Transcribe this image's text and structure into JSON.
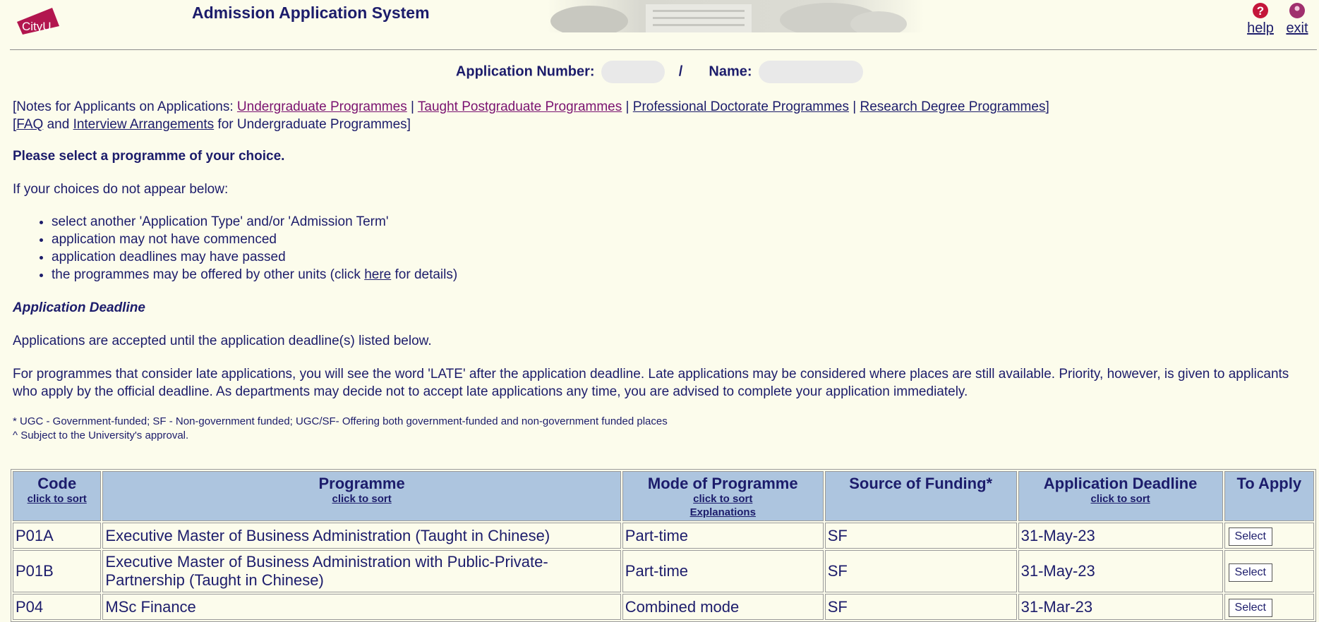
{
  "header": {
    "logo_text": "CityU",
    "title": "Admission Application System",
    "help_label": "help",
    "exit_label": "exit"
  },
  "applicant": {
    "number_label": "Application Number:",
    "separator": "/",
    "name_label": "Name:"
  },
  "notes": {
    "open": "[Notes for Applicants on Applications: ",
    "links": [
      "Undergraduate Programmes",
      "Taught Postgraduate Programmes",
      "Professional Doctorate Programmes",
      "Research Degree Programmes"
    ],
    "sep": " | ",
    "close": "]",
    "line2_open": "[",
    "faq": "FAQ",
    "and": " and ",
    "interview": "Interview Arrangements",
    "line2_close": " for Undergraduate Programmes]"
  },
  "instructions": {
    "select_title": "Please select a programme of your choice.",
    "if_missing": "If your choices do not appear below:",
    "reasons": [
      "select another 'Application Type' and/or 'Admission Term'",
      "application may not have commenced",
      "application deadlines may have passed"
    ],
    "reason4_pre": "the programmes may be offered by other units (click ",
    "reason4_link": "here",
    "reason4_post": " for details)",
    "deadline_heading": "Application Deadline",
    "accepted_text": "Applications are accepted until the application deadline(s) listed below.",
    "late_text": "For programmes that consider late applications, you will see the word 'LATE' after the application deadline. Late applications may be considered where places are still available. Priority, however, is given to applicants who apply by the official deadline. As departments may decide not to accept late applications any time, you are advised to complete your application immediately.",
    "footnote1": "* UGC - Government-funded; SF - Non-government funded; UGC/SF- Offering both government-funded and non-government funded places",
    "footnote2": "^ Subject to the University's approval."
  },
  "table": {
    "headers": {
      "code": "Code",
      "programme": "Programme",
      "mode": "Mode of Programme",
      "funding": "Source of Funding*",
      "deadline": "Application Deadline",
      "apply": "To Apply"
    },
    "sort_label": "click to sort",
    "explanations_label": "Explanations",
    "select_label": "Select",
    "rows": [
      {
        "code": "P01A",
        "programme": "Executive Master of Business Administration (Taught in Chinese)",
        "mode": "Part-time",
        "funding": "SF",
        "deadline": "31-May-23"
      },
      {
        "code": "P01B",
        "programme": "Executive Master of Business Administration with Public-Private-Partnership (Taught in Chinese)",
        "mode": "Part-time",
        "funding": "SF",
        "deadline": "31-May-23"
      },
      {
        "code": "P04",
        "programme": "MSc Finance",
        "mode": "Combined mode",
        "funding": "SF",
        "deadline": "31-Mar-23"
      }
    ]
  },
  "colors": {
    "background": "#fcfcec",
    "text": "#1c1c6b",
    "visited_link": "#7a1270",
    "table_header": "#adc5df",
    "logo": "#b2164f"
  }
}
